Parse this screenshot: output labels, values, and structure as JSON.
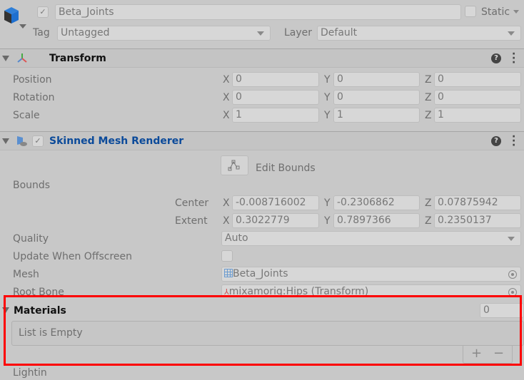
{
  "gameobject": {
    "name": "Beta_Joints",
    "active": true,
    "static_label": "Static",
    "static": false,
    "tag_label": "Tag",
    "tag": "Untagged",
    "layer_label": "Layer",
    "layer": "Default"
  },
  "transform": {
    "title": "Transform",
    "rows": [
      {
        "label": "Position",
        "x": "0",
        "y": "0",
        "z": "0"
      },
      {
        "label": "Rotation",
        "x": "0",
        "y": "0",
        "z": "0"
      },
      {
        "label": "Scale",
        "x": "1",
        "y": "1",
        "z": "1"
      }
    ]
  },
  "axes": {
    "x": "X",
    "y": "Y",
    "z": "Z"
  },
  "smr": {
    "title": "Skinned Mesh Renderer",
    "enabled": true,
    "edit_bounds": "Edit Bounds",
    "bounds_label": "Bounds",
    "center": {
      "label": "Center",
      "x": "-0.008716002",
      "y": "-0.2306862",
      "z": "0.07875942"
    },
    "extent": {
      "label": "Extent",
      "x": "0.3022779",
      "y": "0.7897366",
      "z": "0.2350137"
    },
    "quality_label": "Quality",
    "quality": "Auto",
    "update_offscreen_label": "Update When Offscreen",
    "update_offscreen": false,
    "mesh_label": "Mesh",
    "mesh": "Beta_Joints",
    "root_bone_label": "Root Bone",
    "root_bone": "mixamorig:Hips (Transform)",
    "materials": {
      "label": "Materials",
      "count": "0",
      "empty": "List is Empty",
      "add": "+",
      "remove": "−"
    },
    "next_label": "Lightin"
  },
  "colors": {
    "highlight": "#ff0000",
    "title_blue": "#0b4a9a"
  }
}
